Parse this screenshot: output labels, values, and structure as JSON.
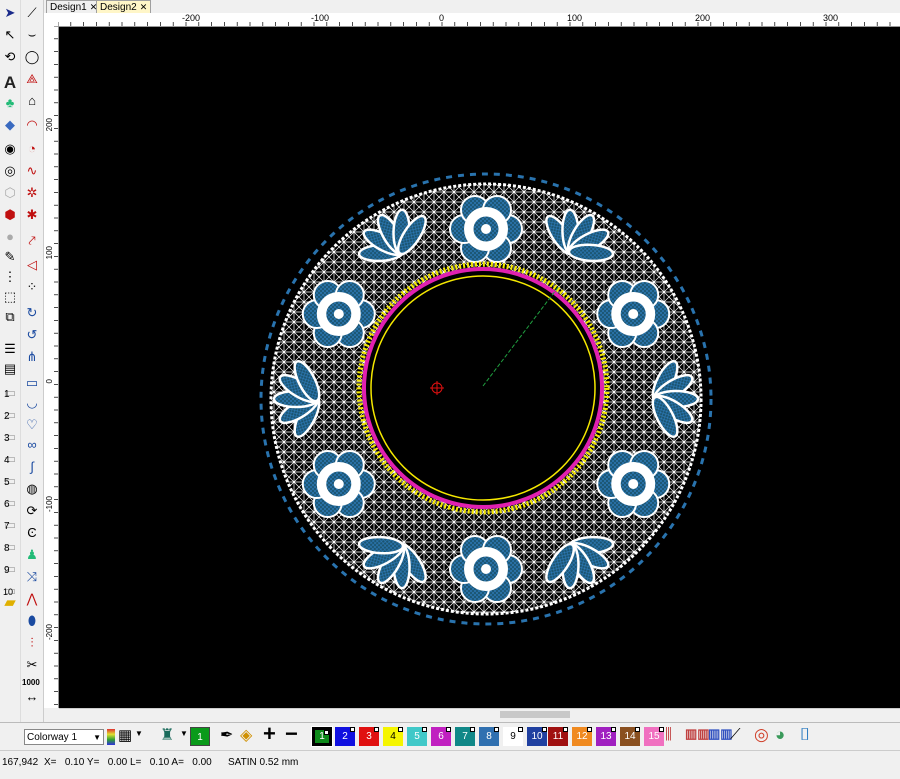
{
  "tabs": [
    {
      "label": "Design1",
      "active": false
    },
    {
      "label": "Design2",
      "active": true
    }
  ],
  "ruler_h": [
    {
      "label": "-200"
    },
    {
      "label": "-100"
    },
    {
      "label": "0"
    },
    {
      "label": "100"
    },
    {
      "label": "200"
    },
    {
      "label": "300"
    }
  ],
  "ruler_v": [
    {
      "label": "200"
    },
    {
      "label": "100"
    },
    {
      "label": "0"
    },
    {
      "label": "-100"
    },
    {
      "label": "-200"
    }
  ],
  "colorway": {
    "selected": "Colorway 1"
  },
  "swatches": [
    {
      "label": "1",
      "color": "#0a9a1a"
    },
    {
      "label": "1",
      "color": "#0d8a1a"
    },
    {
      "label": "2",
      "color": "#1010e0"
    },
    {
      "label": "3",
      "color": "#e01010"
    },
    {
      "label": "4",
      "color": "#f5f500"
    },
    {
      "label": "5",
      "color": "#40c8c8"
    },
    {
      "label": "6",
      "color": "#c020c0"
    },
    {
      "label": "7",
      "color": "#118888"
    },
    {
      "label": "8",
      "color": "#3070b0"
    },
    {
      "label": "9",
      "color": "#ffffff"
    },
    {
      "label": "10",
      "color": "#2040a0"
    },
    {
      "label": "11",
      "color": "#a01010"
    },
    {
      "label": "12",
      "color": "#f08a20"
    },
    {
      "label": "13",
      "color": "#a020c0"
    },
    {
      "label": "14",
      "color": "#8a5020"
    },
    {
      "label": "15",
      "color": "#f070c0"
    }
  ],
  "status": {
    "coords": "167,942",
    "readout": "X=   0.10 Y=   0.00 L=   0.10 A=   0.00",
    "stitch": "SATIN  0.52 mm"
  },
  "left_tool_numbers": [
    "1",
    "2",
    "3",
    "4",
    "5",
    "6",
    "7",
    "8",
    "9",
    "10"
  ],
  "zoom_label": "1000",
  "design_colors": {
    "outline_white": "#ffffff",
    "fill_teal": "#1b5470",
    "edge_blue": "#2e7fc1",
    "ring_magenta": "#e020b0",
    "ring_yellow": "#f5e800",
    "guide_green": "#20a040",
    "center_red": "#e01010"
  }
}
